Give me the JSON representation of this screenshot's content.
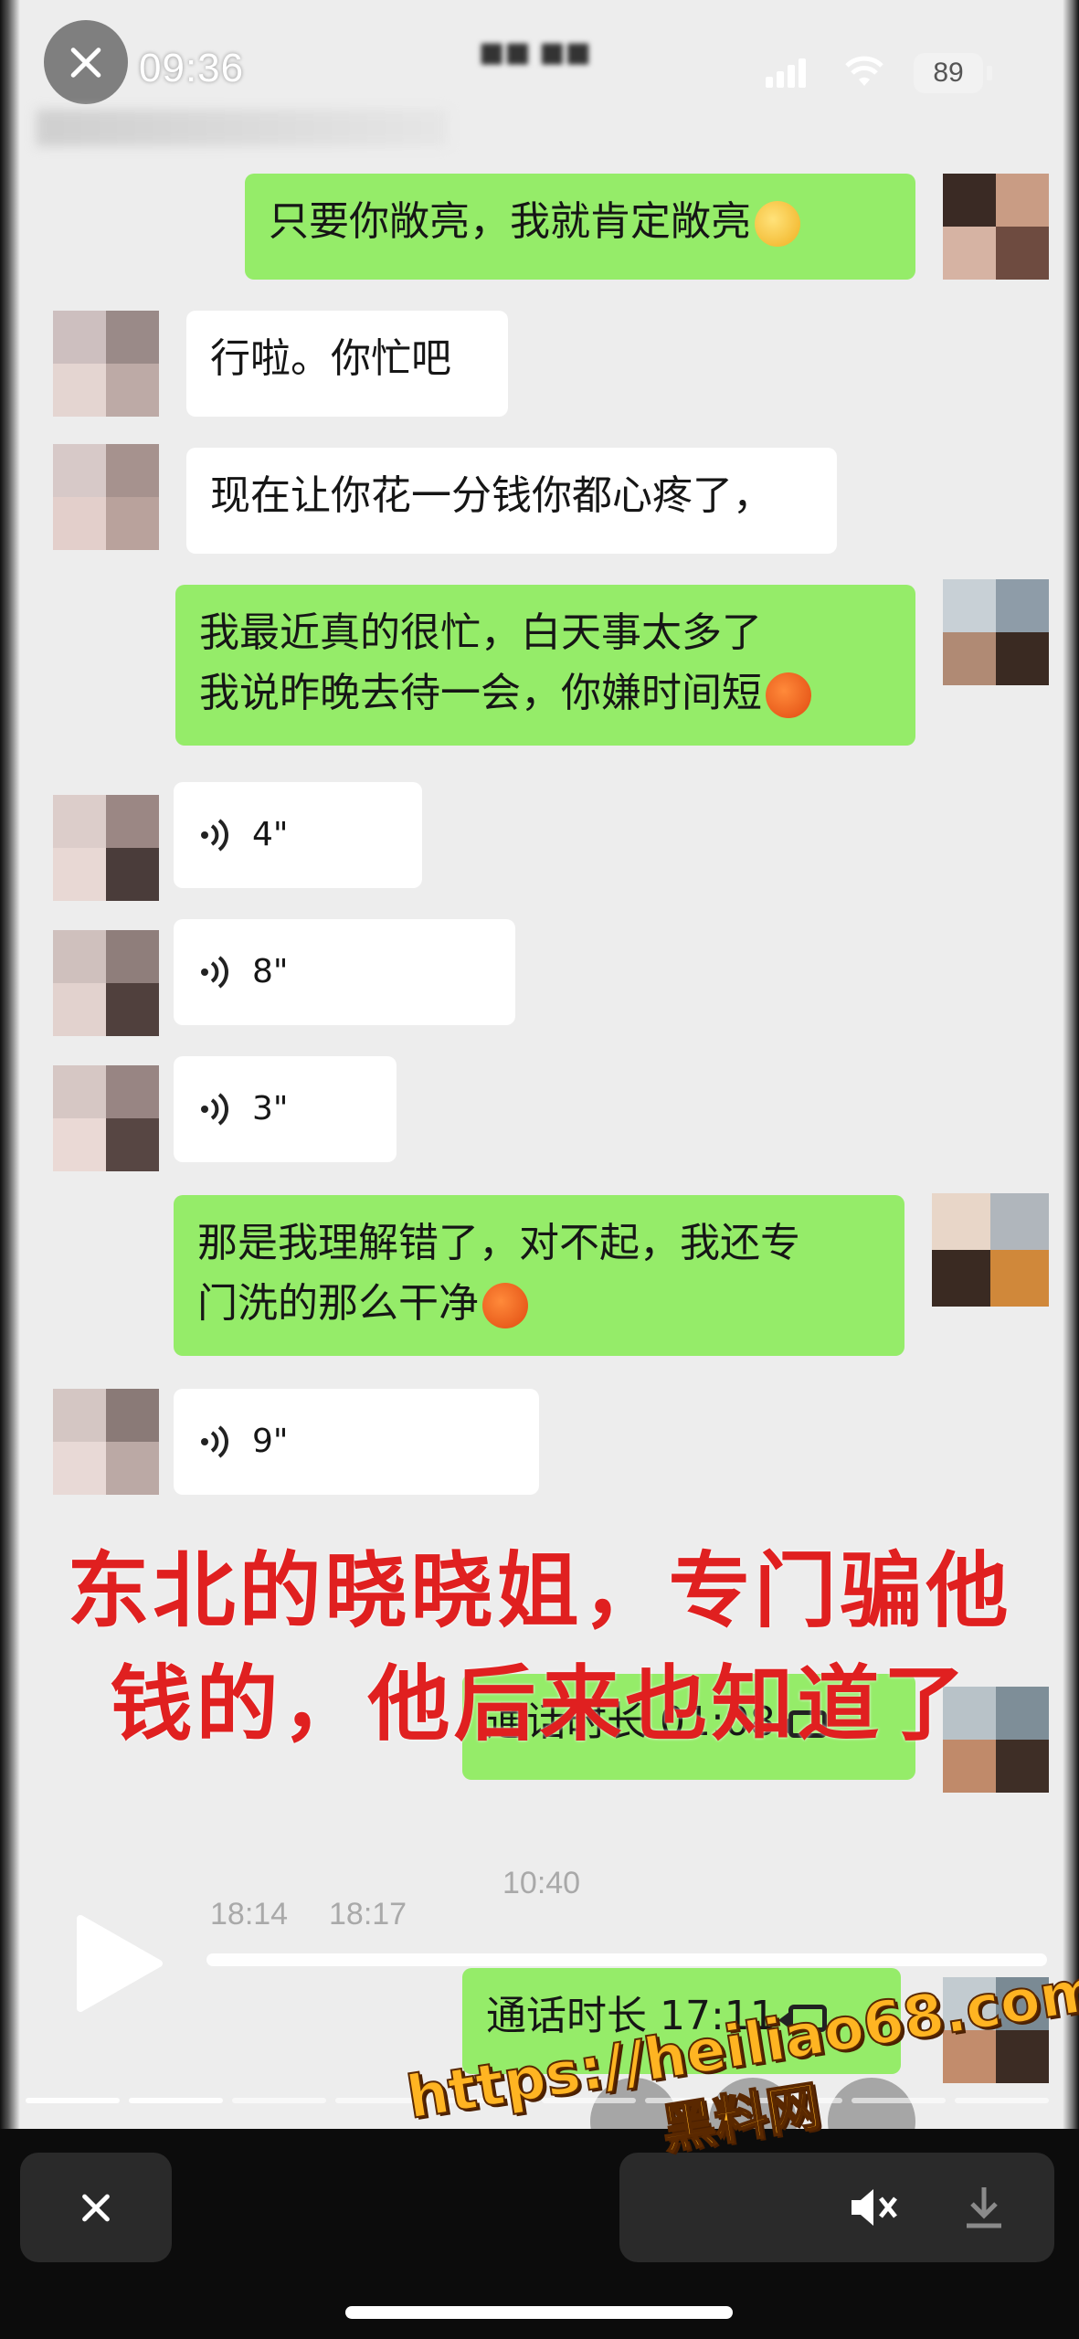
{
  "status_bar": {
    "time": "09:36",
    "battery": "89"
  },
  "chat": {
    "messages": [
      {
        "text": "只要你敞亮，我就肯定敞亮"
      },
      {
        "text": "行啦。你忙吧"
      },
      {
        "text": "现在让你花一分钱你都心疼了，"
      },
      {
        "line1": "我最近真的很忙，白天事太多了",
        "line2": "我说昨晚去待一会，你嫌时间短"
      },
      {
        "duration": "4\""
      },
      {
        "duration": "8\""
      },
      {
        "duration": "3\""
      },
      {
        "line1": "那是我理解错了，对不起，我还专",
        "line2": "门洗的那么干净"
      },
      {
        "duration": "9\""
      },
      {
        "text": "通话时长 01:08"
      },
      {
        "text": "通话时长 17:11"
      }
    ],
    "timestamps": [
      "10:40",
      "18:14",
      "18:17"
    ]
  },
  "overlay_caption": {
    "line1": "东北的晓晓姐，专门骗他",
    "line2": "钱的，他后来也知道了"
  },
  "watermark": {
    "url": "https://heiliao68.com",
    "name": "黑料网"
  },
  "colors": {
    "sent_bubble": "#95ec69",
    "received_bubble": "#ffffff",
    "caption": "#e02020",
    "watermark": "#ffb422"
  }
}
